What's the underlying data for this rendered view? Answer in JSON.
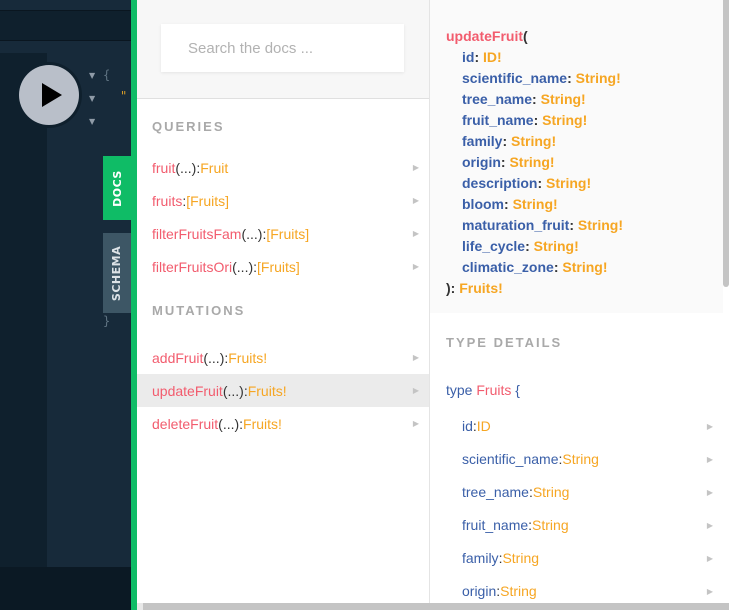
{
  "editor": {
    "run_button_label": "Run",
    "code_open_brace": "{",
    "code_close_brace": "}",
    "code_fragment": "\"",
    "side_tabs": {
      "docs": "DOCS",
      "schema": "SCHEMA"
    }
  },
  "docs": {
    "search_placeholder": "Search the docs ...",
    "queries_title": "QUERIES",
    "queries": [
      {
        "name": "fruit",
        "args": "(...)",
        "colon": ": ",
        "type": "Fruit"
      },
      {
        "name": "fruits",
        "args": "",
        "colon": ": ",
        "type": "[Fruits]"
      },
      {
        "name": "filterFruitsFam",
        "args": "(...)",
        "colon": ": ",
        "type": "[Fruits]"
      },
      {
        "name": "filterFruitsOri",
        "args": "(...)",
        "colon": ": ",
        "type": "[Fruits]"
      }
    ],
    "mutations_title": "MUTATIONS",
    "mutations": [
      {
        "name": "addFruit",
        "args": "(...)",
        "colon": ": ",
        "type": "Fruits!"
      },
      {
        "name": "updateFruit",
        "args": "(...)",
        "colon": ": ",
        "type": "Fruits!",
        "active": true
      },
      {
        "name": "deleteFruit",
        "args": "(...)",
        "colon": ": ",
        "type": "Fruits!"
      }
    ]
  },
  "detail": {
    "fn_name": "updateFruit",
    "open_paren": "(",
    "close": "): ",
    "return_type": "Fruits!",
    "args": [
      {
        "name": "id",
        "type": "ID!"
      },
      {
        "name": "scientific_name",
        "type": "String!"
      },
      {
        "name": "tree_name",
        "type": "String!"
      },
      {
        "name": "fruit_name",
        "type": "String!"
      },
      {
        "name": "family",
        "type": "String!"
      },
      {
        "name": "origin",
        "type": "String!"
      },
      {
        "name": "description",
        "type": "String!"
      },
      {
        "name": "bloom",
        "type": "String!"
      },
      {
        "name": "maturation_fruit",
        "type": "String!"
      },
      {
        "name": "life_cycle",
        "type": "String!"
      },
      {
        "name": "climatic_zone",
        "type": "String!"
      }
    ],
    "type_details_title": "TYPE DETAILS",
    "type_keyword": "type ",
    "type_name": "Fruits",
    "type_brace": " {",
    "fields": [
      {
        "name": "id",
        "type": "ID"
      },
      {
        "name": "scientific_name",
        "type": "String"
      },
      {
        "name": "tree_name",
        "type": "String"
      },
      {
        "name": "fruit_name",
        "type": "String"
      },
      {
        "name": "family",
        "type": "String"
      },
      {
        "name": "origin",
        "type": "String"
      }
    ]
  },
  "colors": {
    "accent_green": "#0fbc66",
    "function_red": "#f25c6e",
    "type_orange": "#f6a623",
    "field_blue": "#3a5fa8"
  }
}
